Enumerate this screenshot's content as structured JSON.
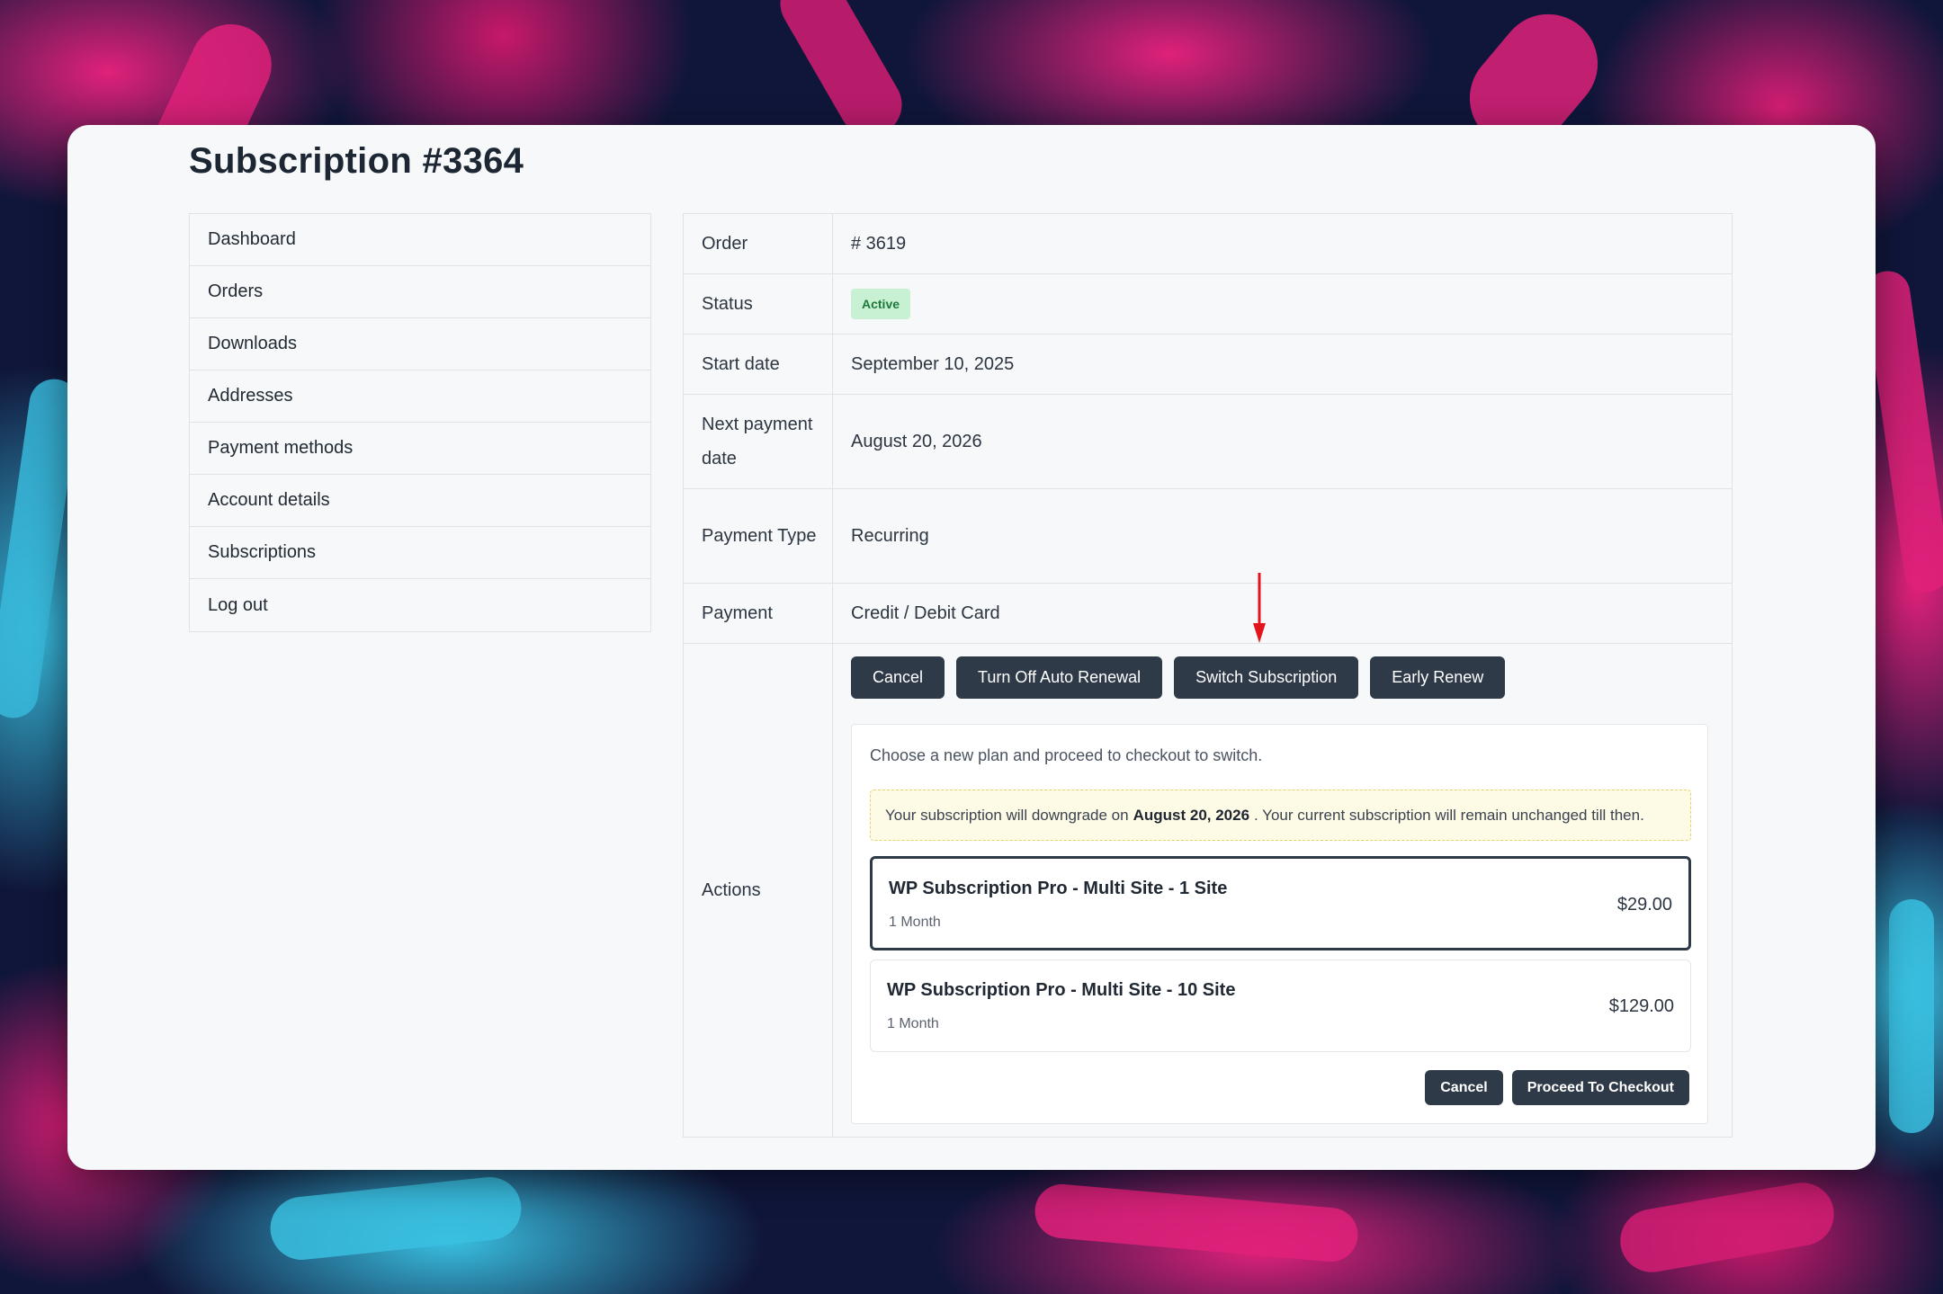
{
  "page": {
    "title": "Subscription #3364"
  },
  "sidebar": {
    "items": [
      {
        "label": "Dashboard"
      },
      {
        "label": "Orders"
      },
      {
        "label": "Downloads"
      },
      {
        "label": "Addresses"
      },
      {
        "label": "Payment methods"
      },
      {
        "label": "Account details"
      },
      {
        "label": "Subscriptions"
      },
      {
        "label": "Log out"
      }
    ]
  },
  "details": {
    "order": {
      "label": "Order",
      "value": "# 3619"
    },
    "status": {
      "label": "Status",
      "value": "Active"
    },
    "start_date": {
      "label": "Start date",
      "value": "September 10, 2025"
    },
    "next_payment": {
      "label": "Next payment date",
      "value": "August 20, 2026"
    },
    "payment_type": {
      "label": "Payment Type",
      "value": "Recurring"
    },
    "payment": {
      "label": "Payment",
      "value": "Credit / Debit Card"
    },
    "actions": {
      "label": "Actions"
    }
  },
  "action_buttons": {
    "cancel": "Cancel",
    "turn_off_auto_renewal": "Turn Off Auto Renewal",
    "switch_subscription": "Switch Subscription",
    "early_renew": "Early Renew"
  },
  "switch_panel": {
    "intro": "Choose a new plan and proceed to checkout to switch.",
    "notice_prefix": "Your subscription will downgrade on",
    "notice_date": "August 20, 2026",
    "notice_suffix": ". Your current subscription will remain unchanged till then.",
    "plans": [
      {
        "name": "WP Subscription Pro - Multi Site - 1 Site",
        "period": "1 Month",
        "price": "$29.00",
        "selected": true
      },
      {
        "name": "WP Subscription Pro - Multi Site - 10 Site",
        "period": "1 Month",
        "price": "$129.00",
        "selected": false
      }
    ],
    "cancel_label": "Cancel",
    "checkout_label": "Proceed To Checkout"
  },
  "colors": {
    "button_bg": "#2f3a48",
    "status_badge_bg": "#c8f0d3",
    "status_badge_text": "#1e7a3c",
    "notice_bg": "#fdfbe6",
    "annotation_arrow": "#e3141b"
  },
  "annotation": {
    "arrow_icon": "red-down-arrow-icon"
  }
}
